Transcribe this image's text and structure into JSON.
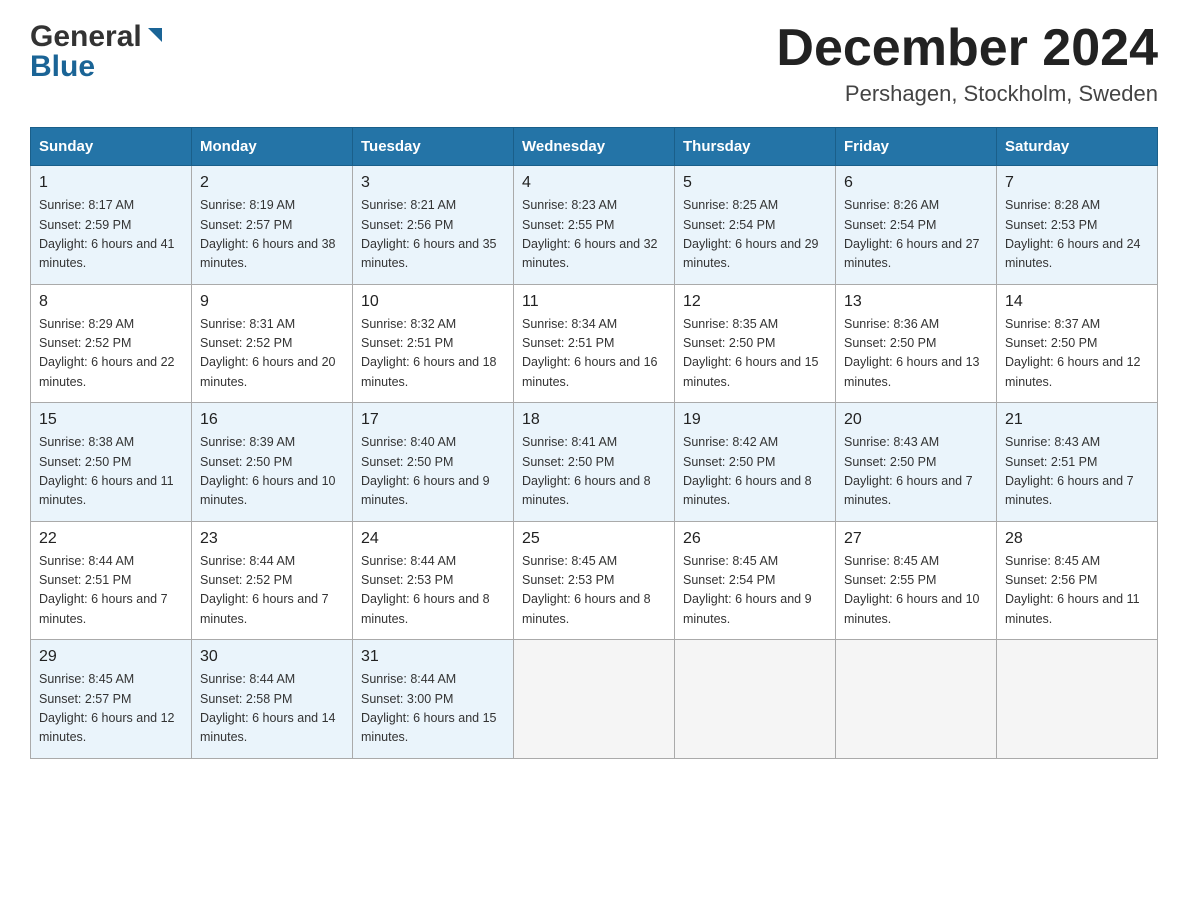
{
  "header": {
    "logo_general": "General",
    "logo_blue": "Blue",
    "month_title": "December 2024",
    "subtitle": "Pershagen, Stockholm, Sweden"
  },
  "days_of_week": [
    "Sunday",
    "Monday",
    "Tuesday",
    "Wednesday",
    "Thursday",
    "Friday",
    "Saturday"
  ],
  "weeks": [
    [
      {
        "day": "1",
        "sunrise": "Sunrise: 8:17 AM",
        "sunset": "Sunset: 2:59 PM",
        "daylight": "Daylight: 6 hours and 41 minutes."
      },
      {
        "day": "2",
        "sunrise": "Sunrise: 8:19 AM",
        "sunset": "Sunset: 2:57 PM",
        "daylight": "Daylight: 6 hours and 38 minutes."
      },
      {
        "day": "3",
        "sunrise": "Sunrise: 8:21 AM",
        "sunset": "Sunset: 2:56 PM",
        "daylight": "Daylight: 6 hours and 35 minutes."
      },
      {
        "day": "4",
        "sunrise": "Sunrise: 8:23 AM",
        "sunset": "Sunset: 2:55 PM",
        "daylight": "Daylight: 6 hours and 32 minutes."
      },
      {
        "day": "5",
        "sunrise": "Sunrise: 8:25 AM",
        "sunset": "Sunset: 2:54 PM",
        "daylight": "Daylight: 6 hours and 29 minutes."
      },
      {
        "day": "6",
        "sunrise": "Sunrise: 8:26 AM",
        "sunset": "Sunset: 2:54 PM",
        "daylight": "Daylight: 6 hours and 27 minutes."
      },
      {
        "day": "7",
        "sunrise": "Sunrise: 8:28 AM",
        "sunset": "Sunset: 2:53 PM",
        "daylight": "Daylight: 6 hours and 24 minutes."
      }
    ],
    [
      {
        "day": "8",
        "sunrise": "Sunrise: 8:29 AM",
        "sunset": "Sunset: 2:52 PM",
        "daylight": "Daylight: 6 hours and 22 minutes."
      },
      {
        "day": "9",
        "sunrise": "Sunrise: 8:31 AM",
        "sunset": "Sunset: 2:52 PM",
        "daylight": "Daylight: 6 hours and 20 minutes."
      },
      {
        "day": "10",
        "sunrise": "Sunrise: 8:32 AM",
        "sunset": "Sunset: 2:51 PM",
        "daylight": "Daylight: 6 hours and 18 minutes."
      },
      {
        "day": "11",
        "sunrise": "Sunrise: 8:34 AM",
        "sunset": "Sunset: 2:51 PM",
        "daylight": "Daylight: 6 hours and 16 minutes."
      },
      {
        "day": "12",
        "sunrise": "Sunrise: 8:35 AM",
        "sunset": "Sunset: 2:50 PM",
        "daylight": "Daylight: 6 hours and 15 minutes."
      },
      {
        "day": "13",
        "sunrise": "Sunrise: 8:36 AM",
        "sunset": "Sunset: 2:50 PM",
        "daylight": "Daylight: 6 hours and 13 minutes."
      },
      {
        "day": "14",
        "sunrise": "Sunrise: 8:37 AM",
        "sunset": "Sunset: 2:50 PM",
        "daylight": "Daylight: 6 hours and 12 minutes."
      }
    ],
    [
      {
        "day": "15",
        "sunrise": "Sunrise: 8:38 AM",
        "sunset": "Sunset: 2:50 PM",
        "daylight": "Daylight: 6 hours and 11 minutes."
      },
      {
        "day": "16",
        "sunrise": "Sunrise: 8:39 AM",
        "sunset": "Sunset: 2:50 PM",
        "daylight": "Daylight: 6 hours and 10 minutes."
      },
      {
        "day": "17",
        "sunrise": "Sunrise: 8:40 AM",
        "sunset": "Sunset: 2:50 PM",
        "daylight": "Daylight: 6 hours and 9 minutes."
      },
      {
        "day": "18",
        "sunrise": "Sunrise: 8:41 AM",
        "sunset": "Sunset: 2:50 PM",
        "daylight": "Daylight: 6 hours and 8 minutes."
      },
      {
        "day": "19",
        "sunrise": "Sunrise: 8:42 AM",
        "sunset": "Sunset: 2:50 PM",
        "daylight": "Daylight: 6 hours and 8 minutes."
      },
      {
        "day": "20",
        "sunrise": "Sunrise: 8:43 AM",
        "sunset": "Sunset: 2:50 PM",
        "daylight": "Daylight: 6 hours and 7 minutes."
      },
      {
        "day": "21",
        "sunrise": "Sunrise: 8:43 AM",
        "sunset": "Sunset: 2:51 PM",
        "daylight": "Daylight: 6 hours and 7 minutes."
      }
    ],
    [
      {
        "day": "22",
        "sunrise": "Sunrise: 8:44 AM",
        "sunset": "Sunset: 2:51 PM",
        "daylight": "Daylight: 6 hours and 7 minutes."
      },
      {
        "day": "23",
        "sunrise": "Sunrise: 8:44 AM",
        "sunset": "Sunset: 2:52 PM",
        "daylight": "Daylight: 6 hours and 7 minutes."
      },
      {
        "day": "24",
        "sunrise": "Sunrise: 8:44 AM",
        "sunset": "Sunset: 2:53 PM",
        "daylight": "Daylight: 6 hours and 8 minutes."
      },
      {
        "day": "25",
        "sunrise": "Sunrise: 8:45 AM",
        "sunset": "Sunset: 2:53 PM",
        "daylight": "Daylight: 6 hours and 8 minutes."
      },
      {
        "day": "26",
        "sunrise": "Sunrise: 8:45 AM",
        "sunset": "Sunset: 2:54 PM",
        "daylight": "Daylight: 6 hours and 9 minutes."
      },
      {
        "day": "27",
        "sunrise": "Sunrise: 8:45 AM",
        "sunset": "Sunset: 2:55 PM",
        "daylight": "Daylight: 6 hours and 10 minutes."
      },
      {
        "day": "28",
        "sunrise": "Sunrise: 8:45 AM",
        "sunset": "Sunset: 2:56 PM",
        "daylight": "Daylight: 6 hours and 11 minutes."
      }
    ],
    [
      {
        "day": "29",
        "sunrise": "Sunrise: 8:45 AM",
        "sunset": "Sunset: 2:57 PM",
        "daylight": "Daylight: 6 hours and 12 minutes."
      },
      {
        "day": "30",
        "sunrise": "Sunrise: 8:44 AM",
        "sunset": "Sunset: 2:58 PM",
        "daylight": "Daylight: 6 hours and 14 minutes."
      },
      {
        "day": "31",
        "sunrise": "Sunrise: 8:44 AM",
        "sunset": "Sunset: 3:00 PM",
        "daylight": "Daylight: 6 hours and 15 minutes."
      },
      null,
      null,
      null,
      null
    ]
  ]
}
